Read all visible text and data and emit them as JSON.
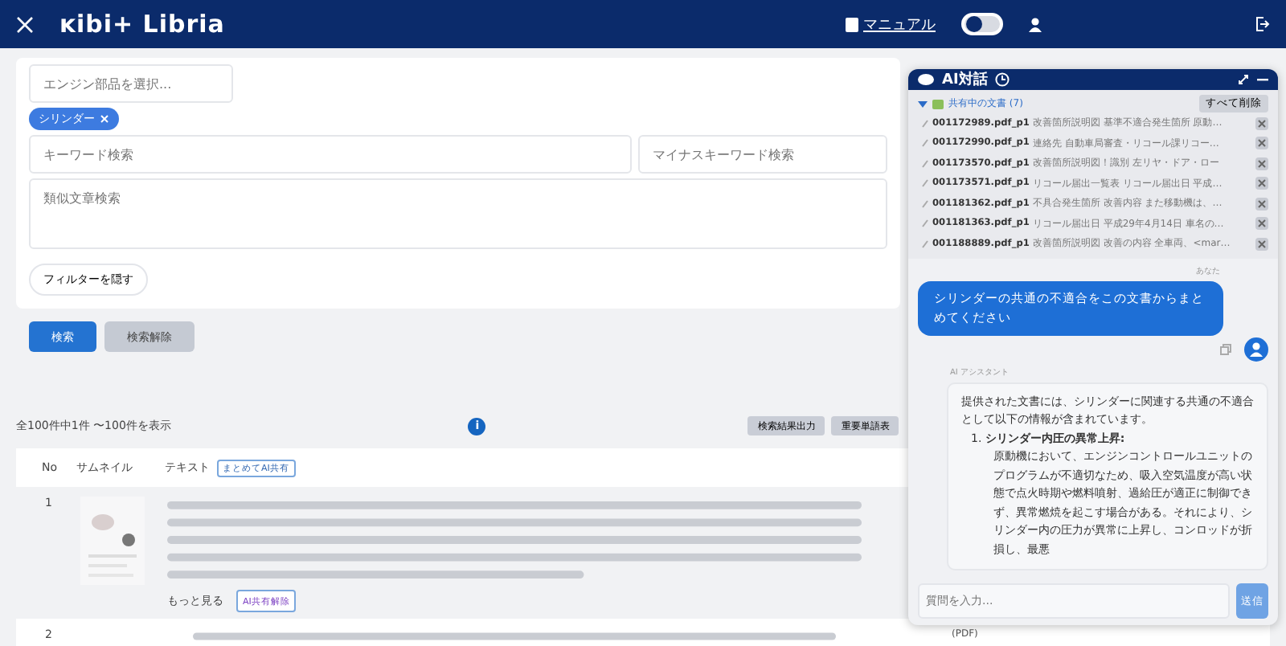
{
  "header": {
    "logo": "ĸibi+ Libria",
    "manual": "マニュアル",
    "toggle": {
      "on": false
    }
  },
  "filters": {
    "part_select": {
      "placeholder": "エンジン部品を選択..."
    },
    "chips": [
      "シリンダー"
    ],
    "keyword": {
      "placeholder": "キーワード検索"
    },
    "minus_keyword": {
      "placeholder": "マイナスキーワード検索"
    },
    "similar": {
      "placeholder": "類似文章検索"
    },
    "toggle_button": "フィルターを隠す"
  },
  "actions": [
    {
      "label": "検索",
      "kind": "primary"
    },
    {
      "label": "検索解除",
      "kind": "secondary"
    }
  ],
  "results": {
    "count": "全100件中1件 〜100件を表示",
    "info_badge": "i",
    "buttons": [
      "検索結果出力",
      "重要単語表"
    ],
    "columns": [
      "No",
      "サムネイル",
      "テキスト"
    ],
    "share_all": "まとめてAI共有",
    "rows": [
      {
        "no": "1",
        "more": "もっと見る",
        "unshare": "AI共有解除"
      },
      {
        "no": "2",
        "file_type": "(PDF)"
      }
    ]
  },
  "chat": {
    "title": "AI対話",
    "shared": {
      "label": "共有中の文書 (7)",
      "expanded": true,
      "clear_all": "すべて削除",
      "docs": [
        {
          "name": "001172989.pdf_p1",
          "snippet": "改善箇所説明図 基準不適合発生箇所 原動…"
        },
        {
          "name": "001172990.pdf_p1",
          "snippet": "連絡先 自動車局審査・リコール課リコー…"
        },
        {
          "name": "001173570.pdf_p1",
          "snippet": "改善箇所説明図！識別 左リヤ・ドア・ロー"
        },
        {
          "name": "001173571.pdf_p1",
          "snippet": "リコール届出一覧表 リコール届出日 平成…"
        },
        {
          "name": "001181362.pdf_p1",
          "snippet": "不具合発生箇所 改善内容 また移動機は、…"
        },
        {
          "name": "001181363.pdf_p1",
          "snippet": "リコール届出日 平成29年4月14日 車名の…"
        },
        {
          "name": "001188889.pdf_p1",
          "snippet": "改善箇所説明図 改善の内容 全車両、<mar…"
        }
      ]
    },
    "messages": [
      {
        "kind": "user",
        "sender": "あなた",
        "text": "シリンダーの共通の不適合をこの文書からまとめてください"
      },
      {
        "kind": "assistant",
        "sender": "AI アシスタント",
        "intro": "提供された文書には、シリンダーに関連する共通の不適合として以下の情報が含まれています。",
        "items": [
          {
            "num": "1.",
            "heading": "シリンダー内圧の異常上昇:",
            "bullets": [
              "原動機において、エンジンコントロールユニットのプログラムが不適切なため、吸入空気温度が高い状態で点火時期や燃料噴射、過給圧が適正に制御できず、異常燃焼を起こす場合がある。それにより、シリンダー内の圧力が異常に上昇し、コンロッドが折損し、最悪"
            ]
          }
        ]
      }
    ],
    "input": {
      "placeholder": "質問を入力..."
    },
    "send": "送信"
  }
}
